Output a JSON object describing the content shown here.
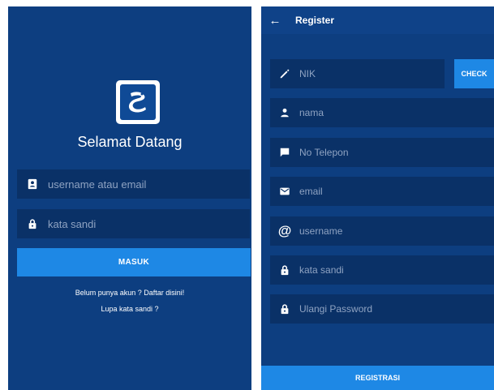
{
  "colors": {
    "background": "#0d3e80",
    "field": "#0a3167",
    "accent": "#1e88e5",
    "placeholder": "#8fa3c2"
  },
  "login": {
    "logo_icon": "dragon-emblem-icon",
    "welcome_title": "Selamat Datang",
    "username_placeholder": "username atau email",
    "username_icon": "contact-card-icon",
    "password_placeholder": "kata sandi",
    "password_icon": "lock-icon",
    "login_button": "MASUK",
    "register_link": "Belum punya akun ? Daftar disini!",
    "forgot_link": "Lupa kata sandi ?"
  },
  "register": {
    "back_icon": "arrow-left-icon",
    "title": "Register",
    "fields": [
      {
        "icon": "pencil-icon",
        "placeholder": "NIK"
      },
      {
        "icon": "person-icon",
        "placeholder": "nama"
      },
      {
        "icon": "message-icon",
        "placeholder": "No Telepon"
      },
      {
        "icon": "email-icon",
        "placeholder": "email"
      },
      {
        "icon": "at-sign-icon",
        "placeholder": "username"
      },
      {
        "icon": "lock-icon",
        "placeholder": "kata sandi"
      },
      {
        "icon": "lock-icon",
        "placeholder": "Ulangi Password"
      }
    ],
    "check_button": "CHECK",
    "submit_button": "REGISTRASI"
  }
}
